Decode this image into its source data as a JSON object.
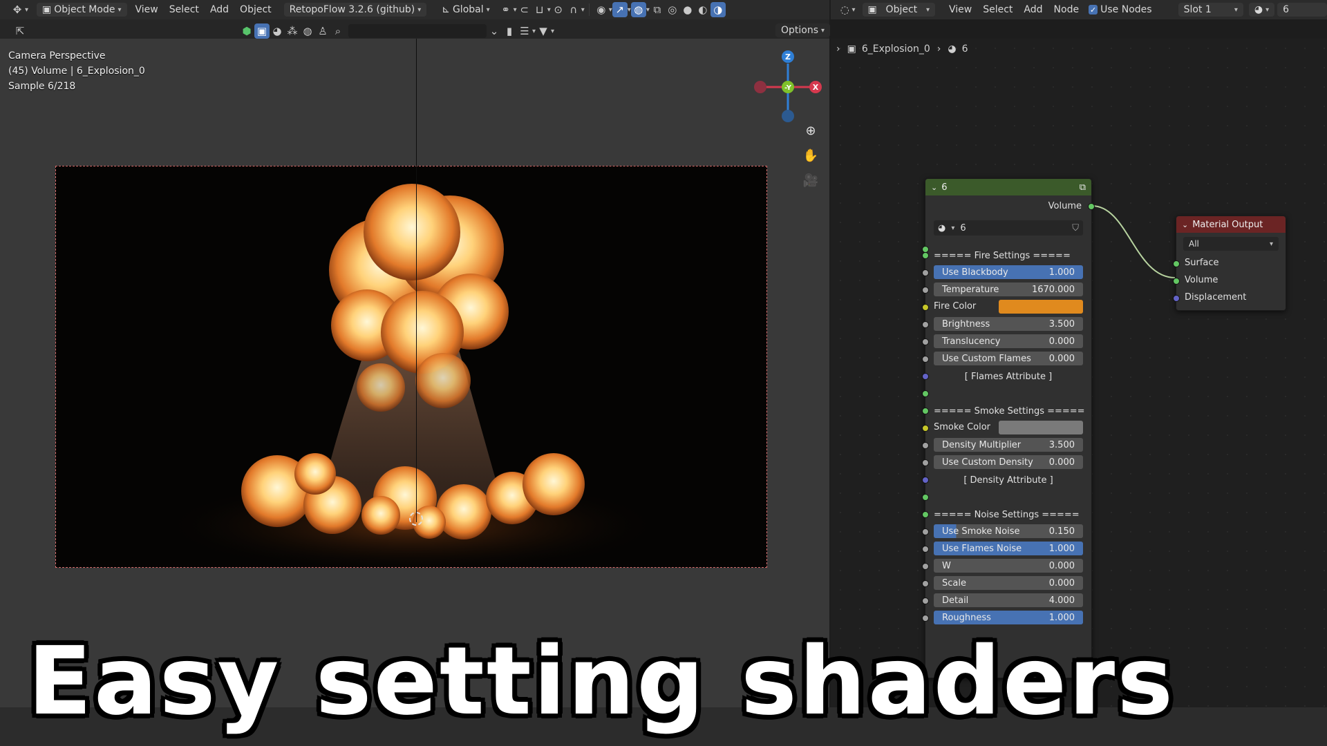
{
  "viewport_header": {
    "mode": "Object Mode",
    "menu": [
      "View",
      "Select",
      "Add",
      "Object"
    ],
    "addon": "RetopoFlow 3.2.6 (github)",
    "orientation": "Global",
    "options": "Options"
  },
  "viewport": {
    "info_lines": [
      "Camera Perspective",
      "(45) Volume | 6_Explosion_0",
      "Sample 6/218"
    ],
    "gizmo": {
      "z": "Z",
      "y": "-Y",
      "x": "X"
    }
  },
  "node_header": {
    "type": "Object",
    "menu": [
      "View",
      "Select",
      "Add",
      "Node"
    ],
    "use_nodes": "Use Nodes",
    "slot": "Slot 1",
    "material": "6"
  },
  "breadcrumb": {
    "object": "6_Explosion_0",
    "material": "6"
  },
  "group_node": {
    "title": "6",
    "output_label": "Volume",
    "datablock": "6",
    "rows": [
      {
        "kind": "header",
        "label": "=====  Fire  Settings  ====="
      },
      {
        "kind": "field",
        "label": "Use Blackbody",
        "value": "1.000",
        "fill": 1.0
      },
      {
        "kind": "field",
        "label": "Temperature",
        "value": "1670.000",
        "fill": 0
      },
      {
        "kind": "color",
        "label": "Fire Color",
        "color": "#e08a1e"
      },
      {
        "kind": "field",
        "label": "Brightness",
        "value": "3.500",
        "fill": 0
      },
      {
        "kind": "field",
        "label": "Translucency",
        "value": "0.000",
        "fill": 0
      },
      {
        "kind": "field",
        "label": "Use Custom Flames",
        "value": "0.000",
        "fill": 0
      },
      {
        "kind": "header",
        "label": "[ Flames Attribute ]"
      },
      {
        "kind": "blank",
        "label": ""
      },
      {
        "kind": "header",
        "label": "===== Smoke Settings ====="
      },
      {
        "kind": "color",
        "label": "Smoke Color",
        "color": "#7a7a7a"
      },
      {
        "kind": "field",
        "label": "Density Multiplier",
        "value": "3.500",
        "fill": 0
      },
      {
        "kind": "field",
        "label": "Use Custom Density",
        "value": "0.000",
        "fill": 0
      },
      {
        "kind": "header",
        "label": "[ Density Attribute ]"
      },
      {
        "kind": "blank",
        "label": ""
      },
      {
        "kind": "header",
        "label": "=====  Noise Settings  ====="
      },
      {
        "kind": "field",
        "label": "Use Smoke Noise",
        "value": "0.150",
        "fill": 0.15
      },
      {
        "kind": "field",
        "label": "Use Flames Noise",
        "value": "1.000",
        "fill": 1.0
      },
      {
        "kind": "field",
        "label": "W",
        "value": "0.000",
        "fill": 0
      },
      {
        "kind": "field",
        "label": "Scale",
        "value": "0.000",
        "fill": 0
      },
      {
        "kind": "field",
        "label": "Detail",
        "value": "4.000",
        "fill": 0
      },
      {
        "kind": "field",
        "label": "Roughness",
        "value": "1.000",
        "fill": 1.0
      }
    ]
  },
  "output_node": {
    "title": "Material Output",
    "target": "All",
    "inputs": [
      "Surface",
      "Volume",
      "Displacement"
    ]
  },
  "caption": "Easy setting shaders"
}
